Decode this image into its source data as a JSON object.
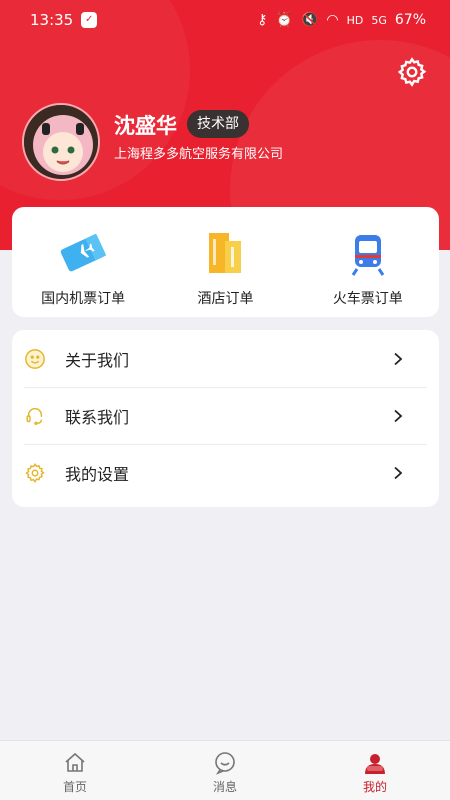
{
  "status_bar": {
    "time": "13:35",
    "network": "HD",
    "signal": "5G",
    "battery": "67%"
  },
  "profile": {
    "name": "沈盛华",
    "department": "技术部",
    "company": "上海程多多航空服务有限公司"
  },
  "orders": [
    {
      "label": "国内机票订单",
      "icon": "airplane-ticket-icon"
    },
    {
      "label": "酒店订单",
      "icon": "hotel-building-icon"
    },
    {
      "label": "火车票订单",
      "icon": "train-icon"
    }
  ],
  "menu": [
    {
      "label": "关于我们",
      "icon": "smile-icon"
    },
    {
      "label": "联系我们",
      "icon": "headset-icon"
    },
    {
      "label": "我的设置",
      "icon": "settings-gear-icon"
    }
  ],
  "tabs": [
    {
      "label": "首页",
      "icon": "home-icon"
    },
    {
      "label": "消息",
      "icon": "message-icon"
    },
    {
      "label": "我的",
      "icon": "user-icon",
      "active": true
    }
  ],
  "colors": {
    "brand_red": "#e8202f",
    "tab_active": "#c8202d",
    "background": "#efeff4"
  }
}
